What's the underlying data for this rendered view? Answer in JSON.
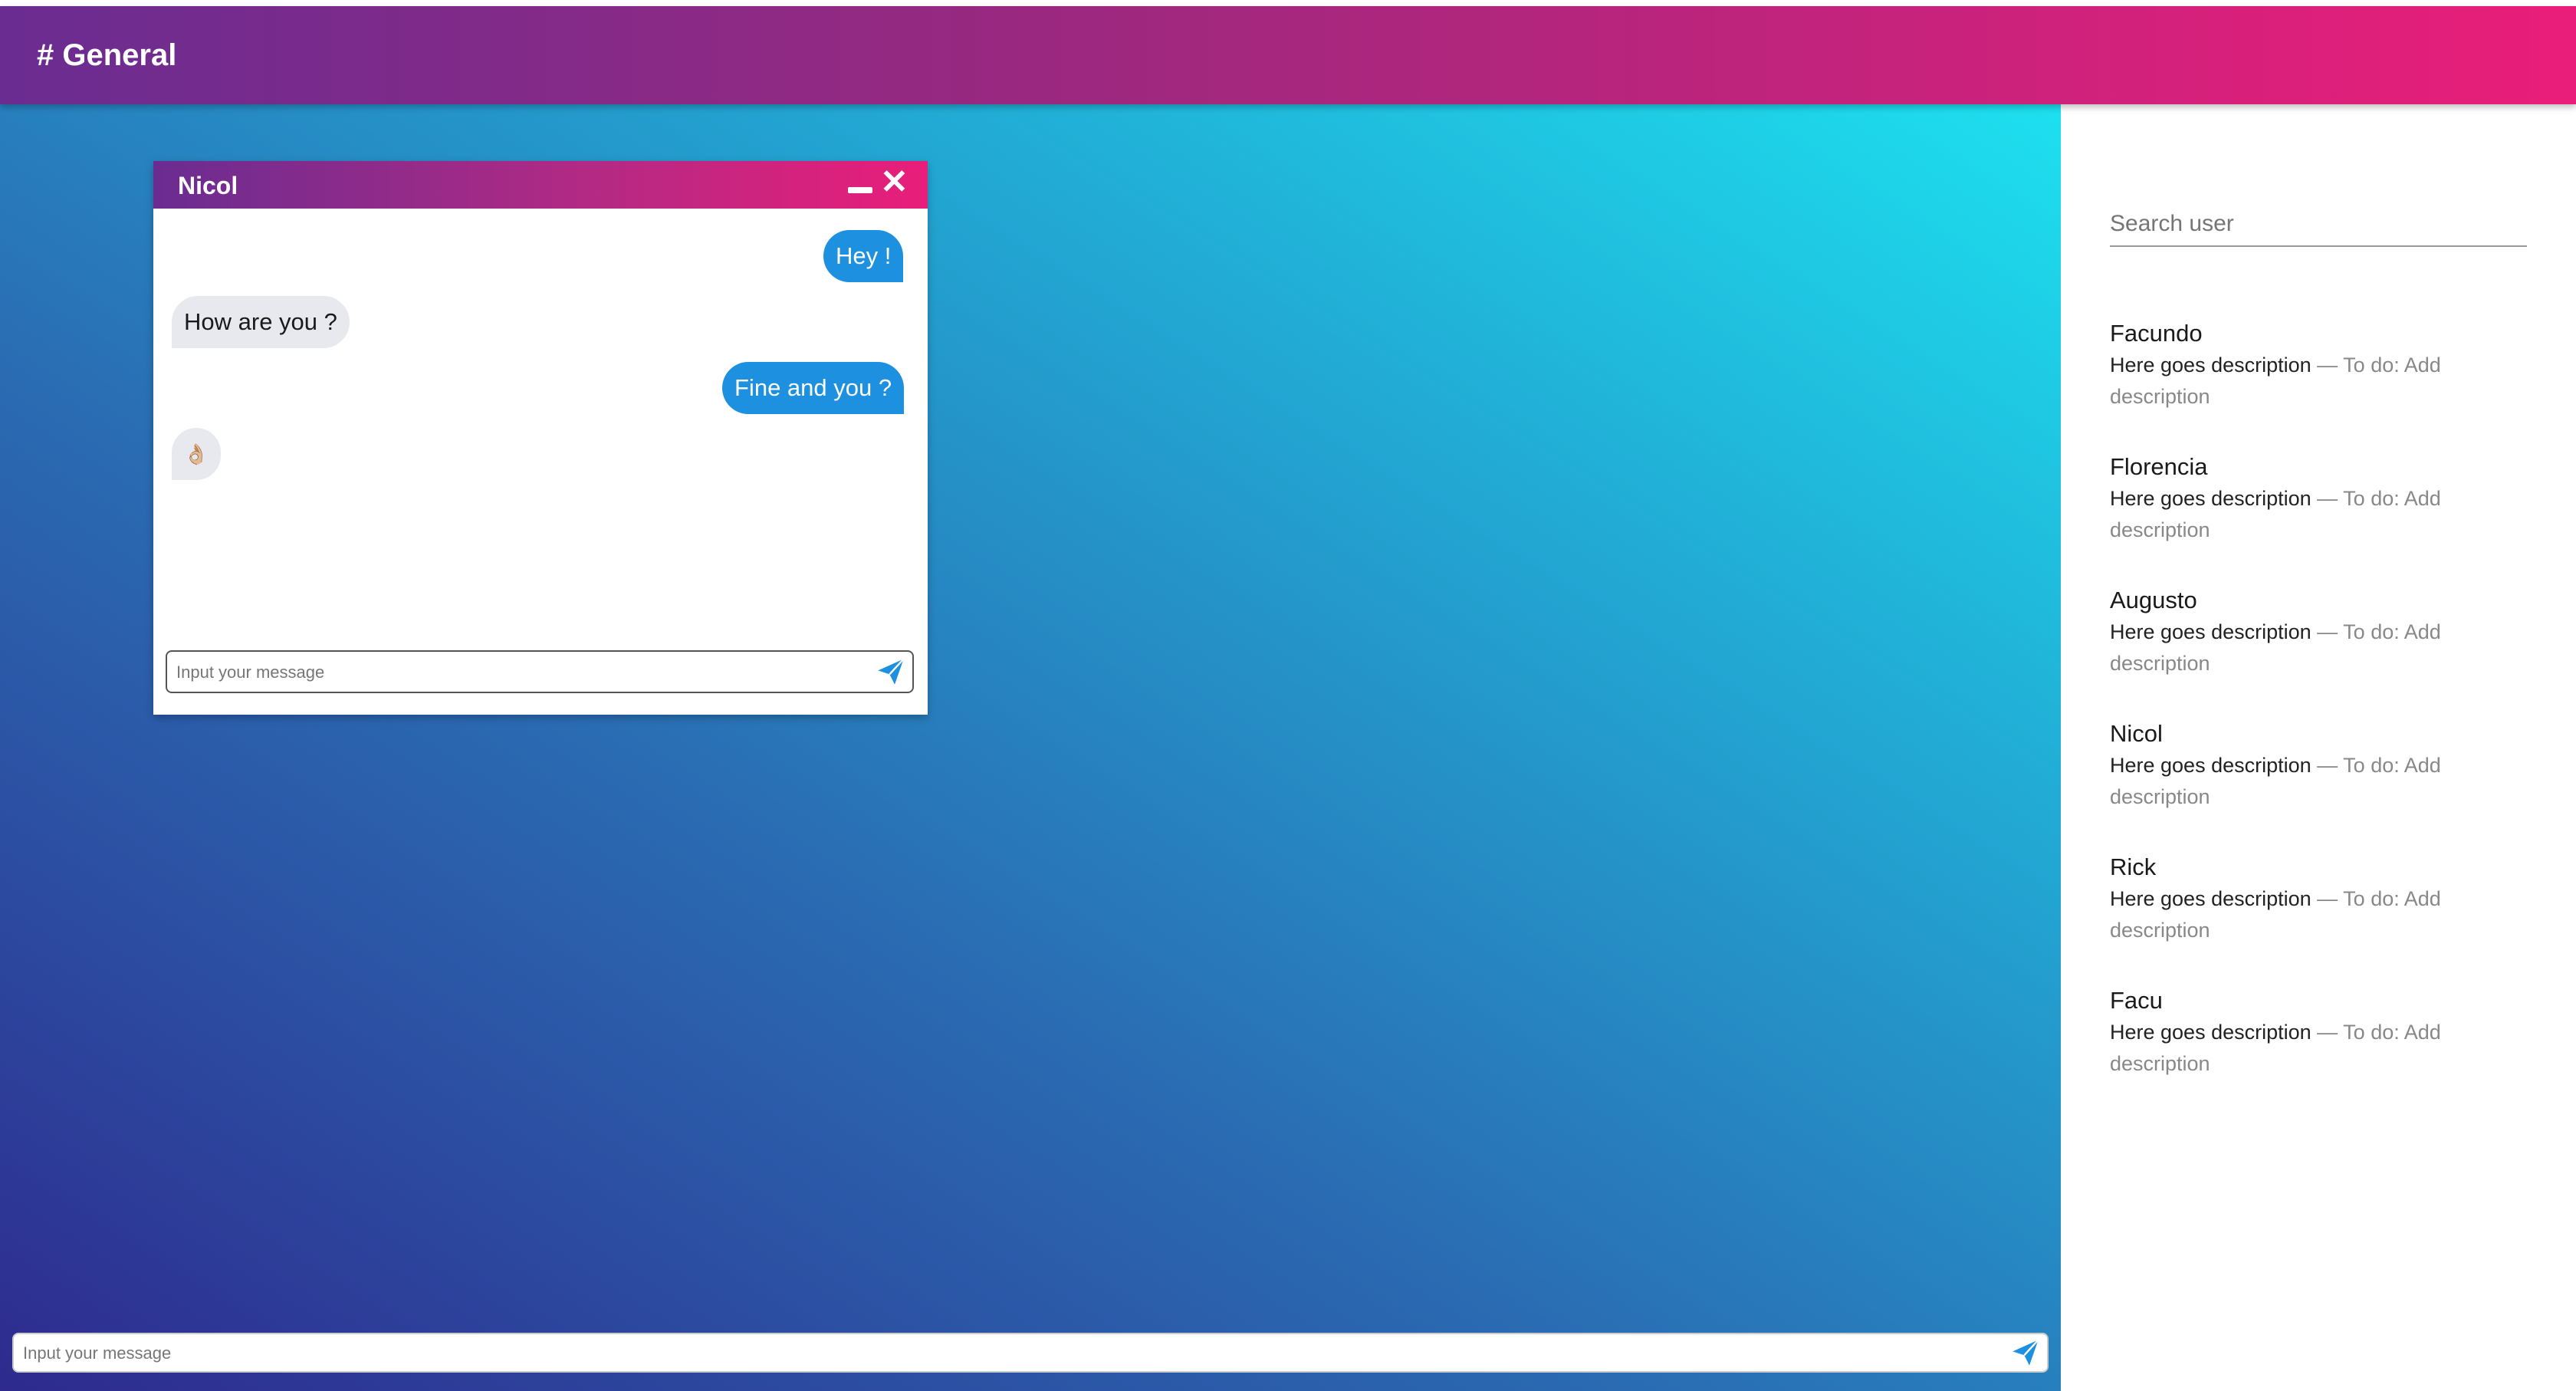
{
  "header": {
    "title": "# General"
  },
  "chat_window": {
    "contact_name": "Nicol",
    "minimize_icon": "minimize-icon",
    "close_icon": "close-icon",
    "close_glyph": "✕",
    "messages": [
      {
        "direction": "out",
        "text": "Hey !"
      },
      {
        "direction": "in",
        "text": "How are you ?"
      },
      {
        "direction": "out",
        "text": "Fine and you ?"
      },
      {
        "direction": "in",
        "text": "👌🏼"
      }
    ],
    "input_placeholder": "Input your message",
    "send_icon": "send-icon"
  },
  "global_input": {
    "placeholder": "Input your message",
    "send_icon": "send-icon"
  },
  "sidebar": {
    "search_placeholder": "Search user",
    "users": [
      {
        "name": "Facundo",
        "desc_primary": "Here goes description",
        "desc_secondary": " — To do: Add description"
      },
      {
        "name": "Florencia",
        "desc_primary": "Here goes description",
        "desc_secondary": " — To do: Add description"
      },
      {
        "name": "Augusto",
        "desc_primary": "Here goes description",
        "desc_secondary": " — To do: Add description"
      },
      {
        "name": "Nicol",
        "desc_primary": "Here goes description",
        "desc_secondary": " — To do: Add description"
      },
      {
        "name": "Rick",
        "desc_primary": "Here goes description",
        "desc_secondary": " — To do: Add description"
      },
      {
        "name": "Facu",
        "desc_primary": "Here goes description",
        "desc_secondary": " — To do: Add description"
      }
    ]
  },
  "colors": {
    "header_gradient_start": "#6a2c91",
    "header_gradient_end": "#e91e7a",
    "bubble_out": "#1e90e0",
    "bubble_in": "#e7e9ee",
    "background_gradient_start": "#2e2a8e",
    "background_gradient_end": "#1de0ef"
  }
}
